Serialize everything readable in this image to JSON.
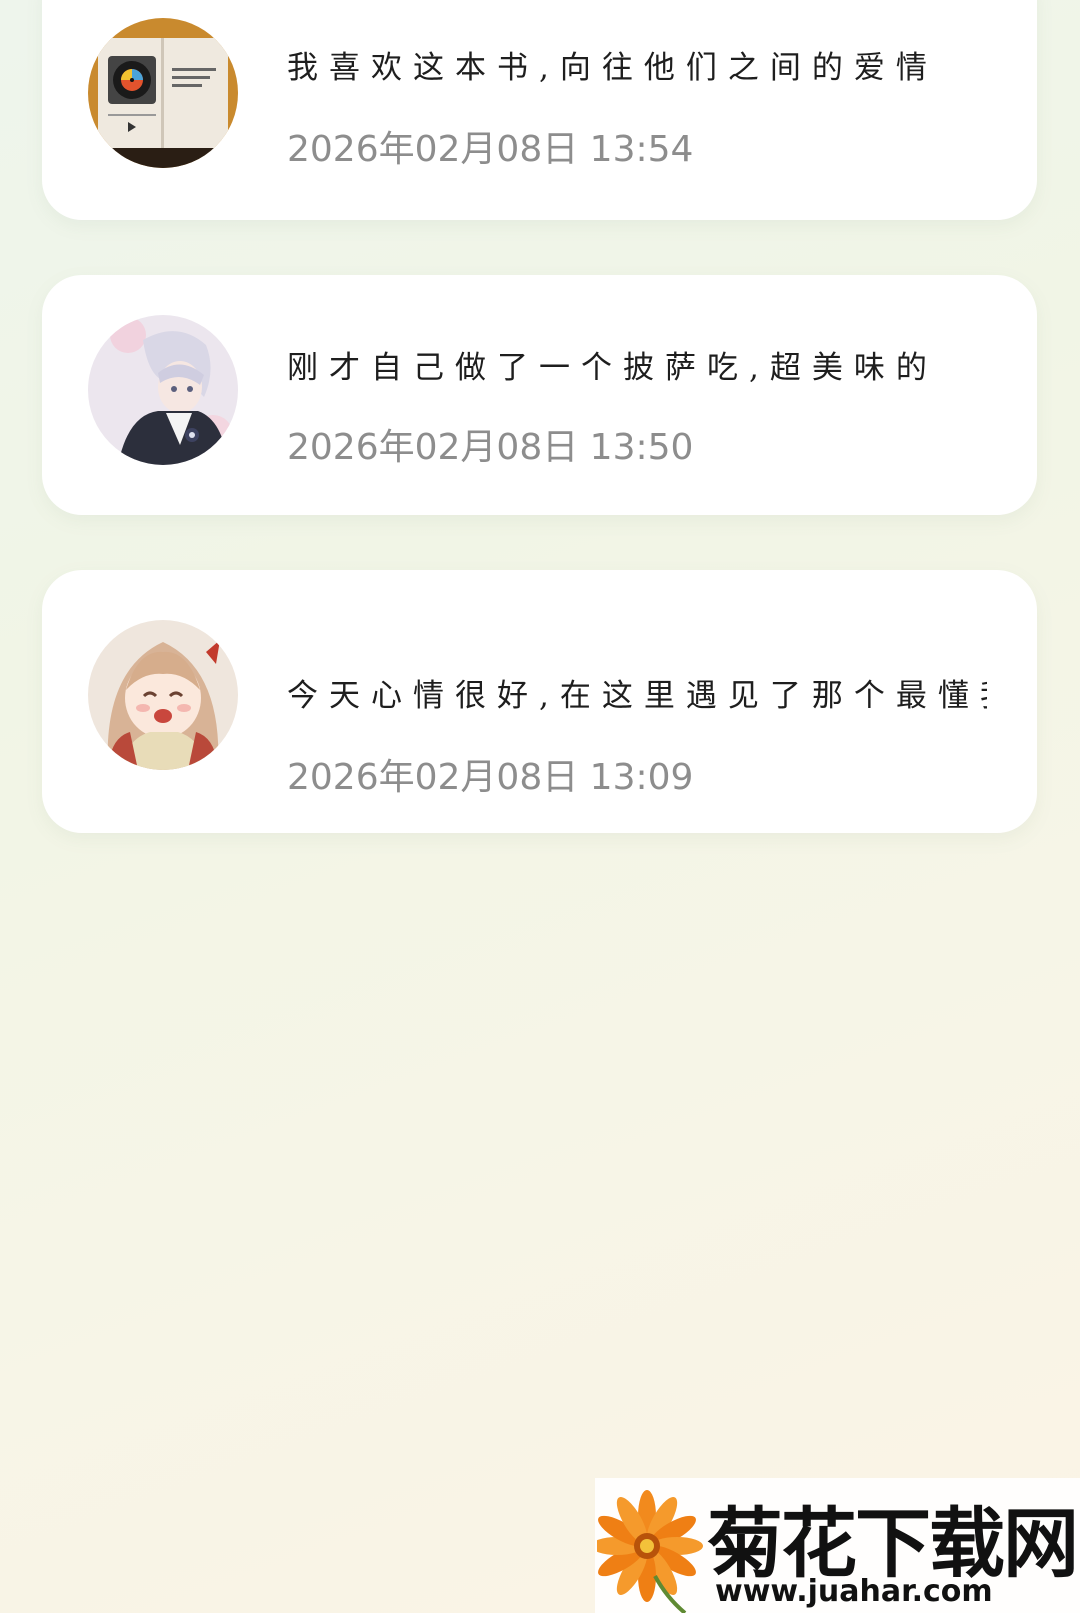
{
  "feed": {
    "items": [
      {
        "text": "我喜欢这本书,向往他们之间的爱情",
        "time": "2026年02月08日 13:54",
        "avatar_icon": "book-vinyl-avatar-icon"
      },
      {
        "text": "刚才自己做了一个披萨吃,超美味的",
        "time": "2026年02月08日 13:50",
        "avatar_icon": "anime-boy-avatar-icon"
      },
      {
        "text": "今天心情很好,在这里遇见了那个最懂我…",
        "time": "2026年02月08日 13:09",
        "avatar_icon": "anime-girl-avatar-icon"
      }
    ]
  },
  "watermark": {
    "title": "菊花下载网",
    "url": "www.juahar.com"
  },
  "colors": {
    "card_bg": "#ffffff",
    "time_text": "#8d8d8d",
    "message_text": "#1e1e1e",
    "watermark_flower": "#f08a1c"
  }
}
